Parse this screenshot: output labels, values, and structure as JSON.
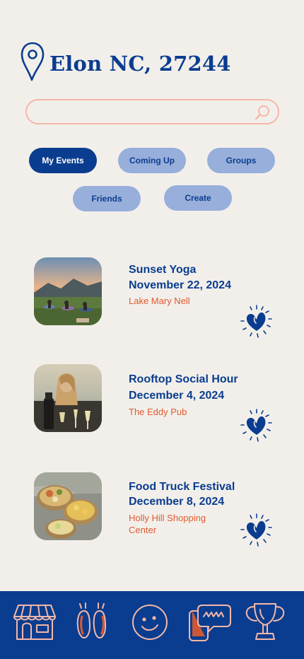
{
  "location": {
    "title": "Elon NC, 27244",
    "icon": "map-pin-icon"
  },
  "search": {
    "placeholder": "",
    "value": "",
    "icon": "search-icon"
  },
  "filters": [
    {
      "label": "My Events",
      "active": true
    },
    {
      "label": "Coming Up",
      "active": false
    },
    {
      "label": "Groups",
      "active": false
    },
    {
      "label": "Friends",
      "active": false
    },
    {
      "label": "Create",
      "active": false
    }
  ],
  "events": [
    {
      "title": "Sunset Yoga",
      "date": "November 22, 2024",
      "venue": "Lake Mary Nell",
      "image": "yoga-sunset-photo",
      "favorite_icon": "heart-sparkle-icon"
    },
    {
      "title": "Rooftop Social Hour",
      "date": "December 4, 2024",
      "venue": "The Eddy Pub",
      "image": "rooftop-drinks-photo",
      "favorite_icon": "heart-sparkle-icon"
    },
    {
      "title": "Food Truck Festival",
      "date": "December 8, 2024",
      "venue": "Holly Hill Shopping Center",
      "image": "food-truck-photo",
      "favorite_icon": "heart-sparkle-icon"
    }
  ],
  "nav": [
    {
      "icon": "storefront-icon"
    },
    {
      "icon": "footprints-icon"
    },
    {
      "icon": "smiley-face-icon"
    },
    {
      "icon": "chat-phone-icon"
    },
    {
      "icon": "trophy-icon"
    }
  ],
  "colors": {
    "background": "#f2efeb",
    "primary": "#0a3d8f",
    "pill": "#98aedb",
    "accent": "#e05a2e",
    "nav_icon": "#f5b7a8"
  }
}
